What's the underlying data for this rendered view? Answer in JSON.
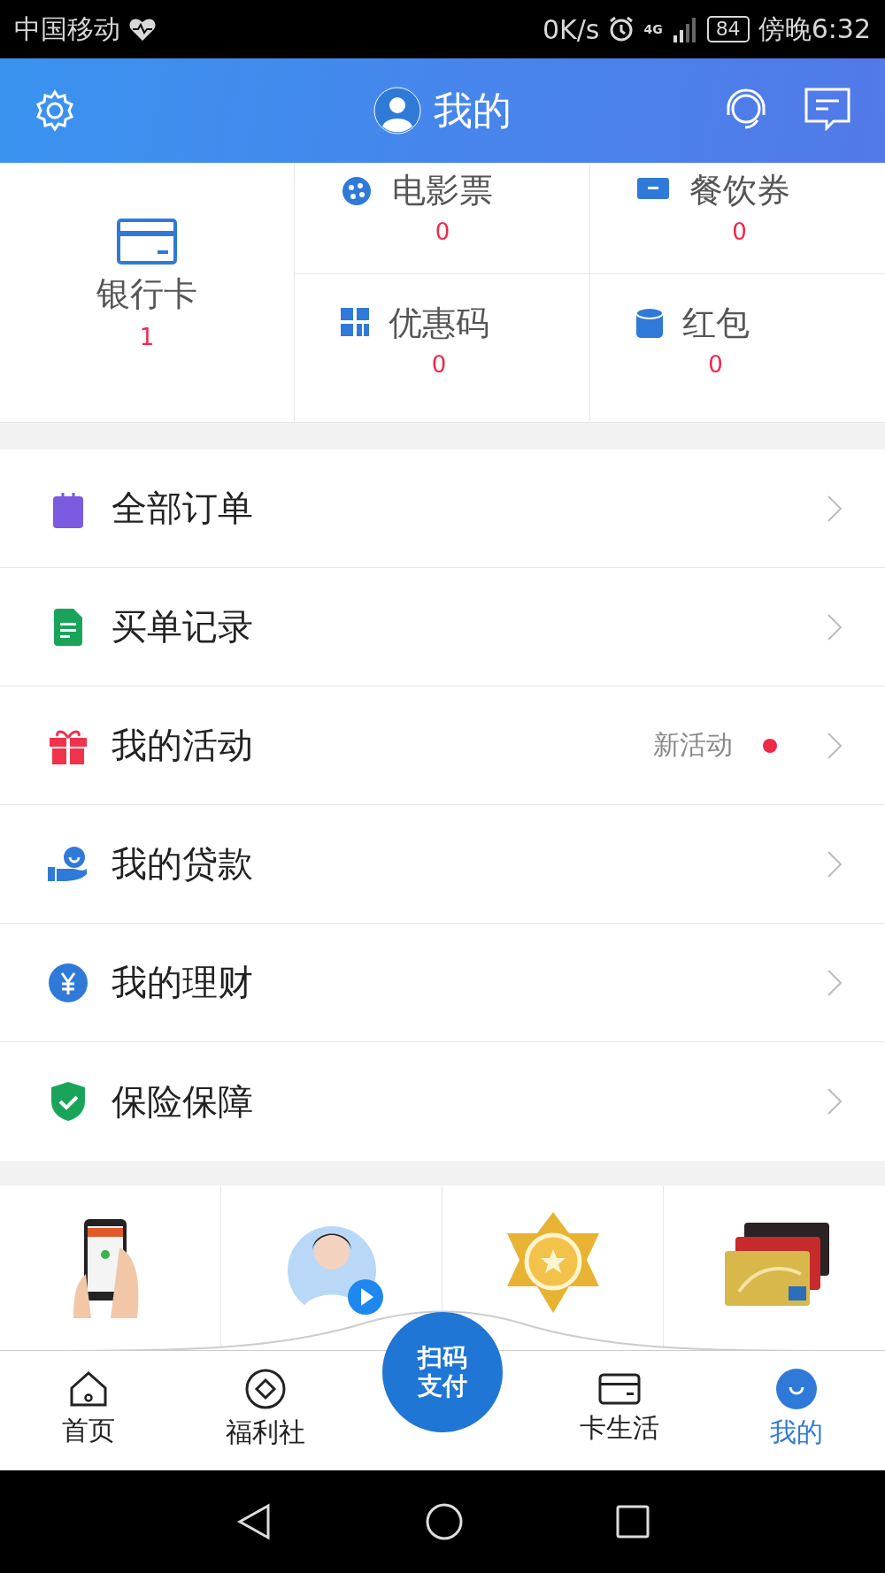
{
  "status_bar": {
    "carrier": "中国移动",
    "speed": "0K/s",
    "network": "4G",
    "battery": "84",
    "time": "傍晚6:32"
  },
  "header": {
    "title": "我的"
  },
  "assets": {
    "main": {
      "label": "银行卡",
      "count": "1"
    },
    "grid": [
      {
        "label": "电影票",
        "count": "0"
      },
      {
        "label": "餐饮券",
        "count": "0"
      },
      {
        "label": "优惠码",
        "count": "0"
      },
      {
        "label": "红包",
        "count": "0"
      }
    ]
  },
  "menu": [
    {
      "label": "全部订单"
    },
    {
      "label": "买单记录"
    },
    {
      "label": "我的活动",
      "badge": "新活动",
      "dot": true
    },
    {
      "label": "我的贷款"
    },
    {
      "label": "我的理财"
    },
    {
      "label": "保险保障"
    }
  ],
  "tab_bar": {
    "items": [
      {
        "label": "首页",
        "selected": false
      },
      {
        "label": "福利社",
        "selected": false
      },
      {
        "label": "卡生活",
        "selected": false
      },
      {
        "label": "我的",
        "selected": true
      }
    ],
    "scan_button": [
      "扫码",
      "支付"
    ]
  }
}
